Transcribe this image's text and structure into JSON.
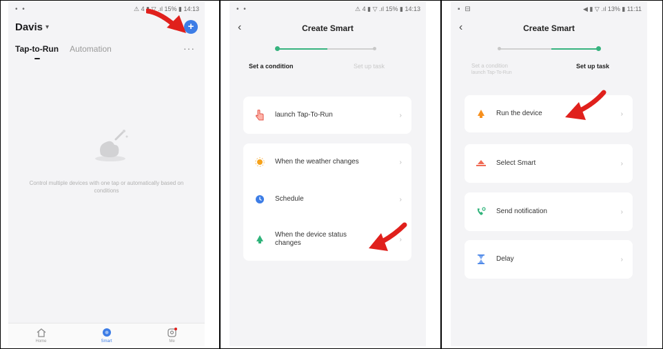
{
  "colors": {
    "accent": "#3d7de6",
    "step_active": "#36b37e",
    "arrow": "#e0201c",
    "background": "#f4f4f6",
    "card": "#ffffff"
  },
  "screen1": {
    "status_left": "• •",
    "status_right": "⚠ 4 ▮ ▽ .ıl 15% ▮ 14:13",
    "home_name": "Davis",
    "home_chevron": "▾",
    "add_button": "+",
    "tabs": [
      {
        "label": "Tap-to-Run",
        "active": true
      },
      {
        "label": "Automation",
        "active": false
      }
    ],
    "more": "···",
    "empty_text": "Control multiple devices with one tap or automatically based on conditions",
    "nav": [
      {
        "label": "Home",
        "icon": "home-icon",
        "active": false
      },
      {
        "label": "Smart",
        "icon": "smart-icon",
        "active": true
      },
      {
        "label": "Me",
        "icon": "me-icon",
        "active": false
      }
    ]
  },
  "screen2": {
    "status_left": "• •",
    "status_right": "⚠ 4 ▮ ▽ .ıl 15% ▮ 14:13",
    "back": "‹",
    "title": "Create Smart",
    "step1_label": "Set a condition",
    "step2_label": "Set up task",
    "items": [
      {
        "label": "launch Tap-To-Run",
        "icon": "hand-tap-icon"
      },
      {
        "label": "When the weather changes",
        "icon": "sun-icon"
      },
      {
        "label": "Schedule",
        "icon": "clock-icon"
      },
      {
        "label": "When the device status changes",
        "icon": "device-icon"
      }
    ],
    "chevron": "›"
  },
  "screen3": {
    "status_left": "▪ ⊟",
    "status_right": "◀ ▮ ▽ .ıl 13% ▮ 11:11",
    "back": "‹",
    "title": "Create Smart",
    "step1_label": "Set a condition",
    "step1_sub": "launch Tap-To-Run",
    "step2_label": "Set up task",
    "items": [
      {
        "label": "Run the device",
        "icon": "device-icon"
      },
      {
        "label": "Select Smart",
        "icon": "smart-scene-icon"
      },
      {
        "label": "Send notification",
        "icon": "notification-icon"
      },
      {
        "label": "Delay",
        "icon": "hourglass-icon"
      }
    ],
    "chevron": "›"
  }
}
